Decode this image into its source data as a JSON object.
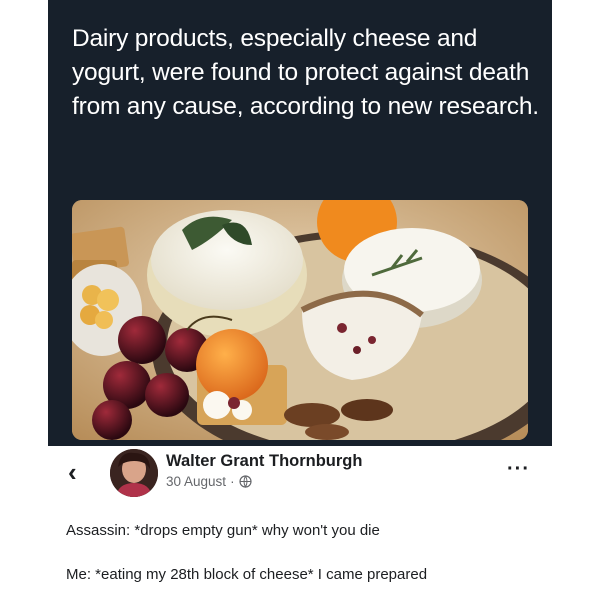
{
  "tweet": {
    "headline": "Dairy products, especially cheese and yogurt, were found to protect against death from any cause, according to new research."
  },
  "post": {
    "author": "Walter Grant Thornburgh",
    "date": "30 August",
    "separator": "·",
    "line1": "Assassin: *drops empty gun* why won't you die",
    "line2": "Me: *eating my 28th block of cheese* I came prepared"
  },
  "icons": {
    "back": "back-arrow-icon",
    "more": "more-options-icon",
    "privacy": "globe-icon"
  },
  "colors": {
    "tweet_background": "#17202b",
    "text_dark": "#1c1e21",
    "text_muted": "#65676b"
  }
}
